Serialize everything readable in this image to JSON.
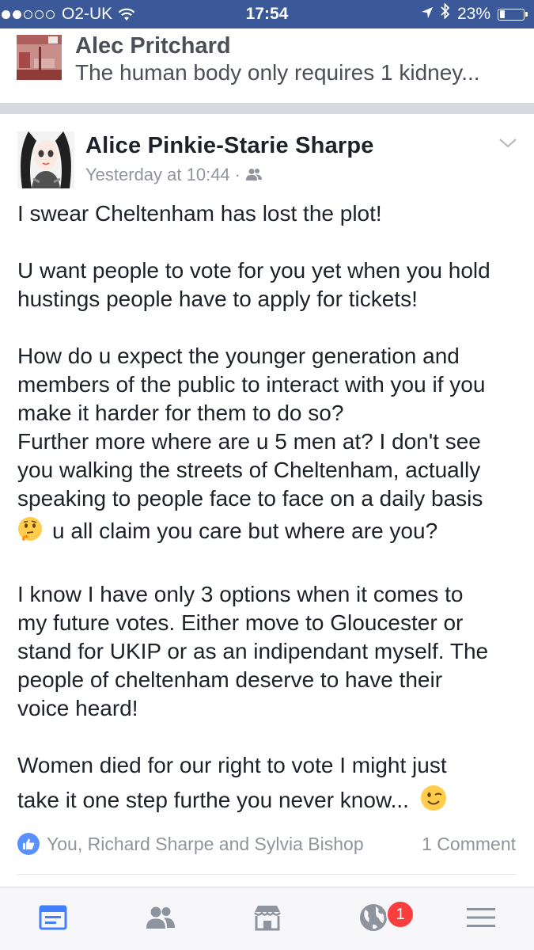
{
  "status_bar": {
    "carrier": "O2-UK",
    "time": "17:54",
    "battery_percent": "23%",
    "battery_level": 0.23,
    "signal_bars_filled": 2,
    "signal_bars_total": 5
  },
  "shared_story": {
    "author": "Alec Pritchard",
    "preview_text": "The human body only requires 1 kidney..."
  },
  "post": {
    "author": "Alice Pinkie-Starie Sharpe",
    "timestamp": "Yesterday at 10:44",
    "separator": "·",
    "audience_icon": "friends-icon",
    "lines": {
      "l1": "I swear Cheltenham has lost the plot!",
      "l2": "U want people to vote for you yet when you hold",
      "l3": "hustings people have to apply for tickets!",
      "l4": "How do u expect the younger generation and",
      "l5": "members of the public to interact with you if you",
      "l6": "make it harder for them to do so?",
      "l7": "Further more where are u 5 men at? I don't see",
      "l8": "you walking the streets of Cheltenham, actually",
      "l9": "speaking to people face to face on a daily basis",
      "l10": "u all claim you care but where are you?",
      "l11": "I know I have only 3 options when it comes to",
      "l12": "my future votes. Either move to Gloucester or",
      "l13": "stand for UKIP or as an indipendant myself. The",
      "l14": "people of cheltenham deserve to have their",
      "l15": "voice heard!",
      "l16": "Women died for our right to vote I might just",
      "l17": "take it one step furthe you never know..."
    },
    "emojis": [
      "thinking-face-icon",
      "winking-face-icon"
    ],
    "reactions_text": "You, Richard Sharpe and Sylvia Bishop",
    "comment_count": "1 Comment"
  },
  "tab_bar": {
    "tabs": [
      "news-feed-icon",
      "friends-icon",
      "marketplace-icon",
      "notifications-globe-icon",
      "menu-icon"
    ],
    "notification_badge": "1"
  },
  "colors": {
    "brand_blue": "#3b5998",
    "like_blue": "#5890ff",
    "badge_red": "#fa3e3e",
    "meta_grey": "#90949c"
  }
}
